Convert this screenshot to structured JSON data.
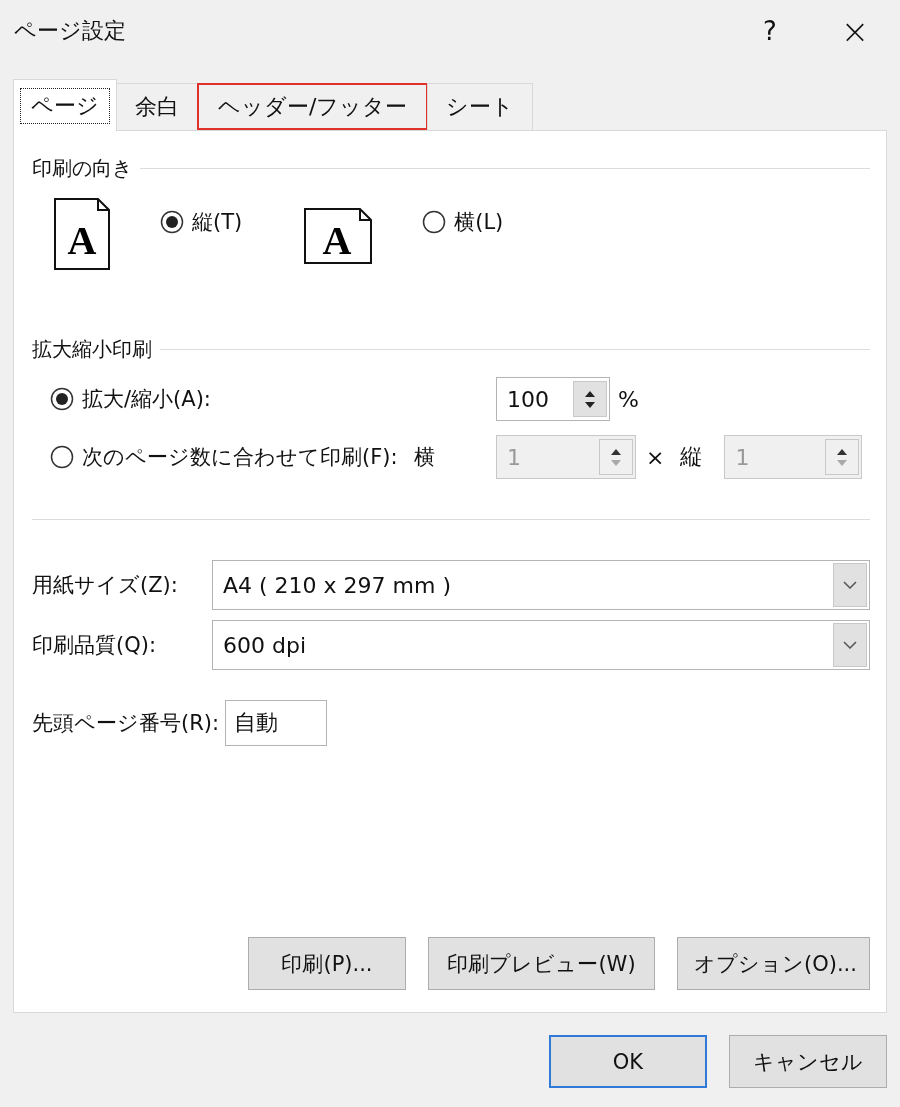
{
  "window": {
    "title": "ページ設定",
    "help": "?",
    "close": "×"
  },
  "tabs": [
    {
      "label": "ページ",
      "selected": true,
      "focused": true,
      "highlighted": false
    },
    {
      "label": "余白",
      "selected": false,
      "focused": false,
      "highlighted": false
    },
    {
      "label": "ヘッダー/フッター",
      "selected": false,
      "focused": false,
      "highlighted": true
    },
    {
      "label": "シート",
      "selected": false,
      "focused": false,
      "highlighted": false
    }
  ],
  "orientation": {
    "title": "印刷の向き",
    "options": [
      {
        "kind": "portrait",
        "letter": "A",
        "label": "縦(T)",
        "selected": true
      },
      {
        "kind": "landscape",
        "letter": "A",
        "label": "横(L)",
        "selected": false
      }
    ]
  },
  "scaling": {
    "title": "拡大縮小印刷",
    "options": [
      {
        "kind": "percent",
        "label": "拡大/縮小(A):",
        "selected": true,
        "value": "100",
        "disabled": false,
        "unit": "%"
      },
      {
        "kind": "fit",
        "label": "次のページ数に合わせて印刷(F):",
        "selected": false,
        "wide_label": "横",
        "wide_value": "1",
        "times": "×",
        "tall_label": "縦",
        "tall_value": "1",
        "disabled": true
      }
    ]
  },
  "paper_size": {
    "label": "用紙サイズ(Z):",
    "value": "A4 ( 210 x 297 mm )"
  },
  "print_quality": {
    "label": "印刷品質(Q):",
    "value": "600 dpi"
  },
  "first_page": {
    "label": "先頭ページ番号(R):",
    "value": "自動"
  },
  "actions": [
    "印刷(P)...",
    "印刷プレビュー(W)",
    "オプション(O)..."
  ],
  "buttons": [
    {
      "label": "OK",
      "default": true
    },
    {
      "label": "キャンセル",
      "default": false
    }
  ]
}
